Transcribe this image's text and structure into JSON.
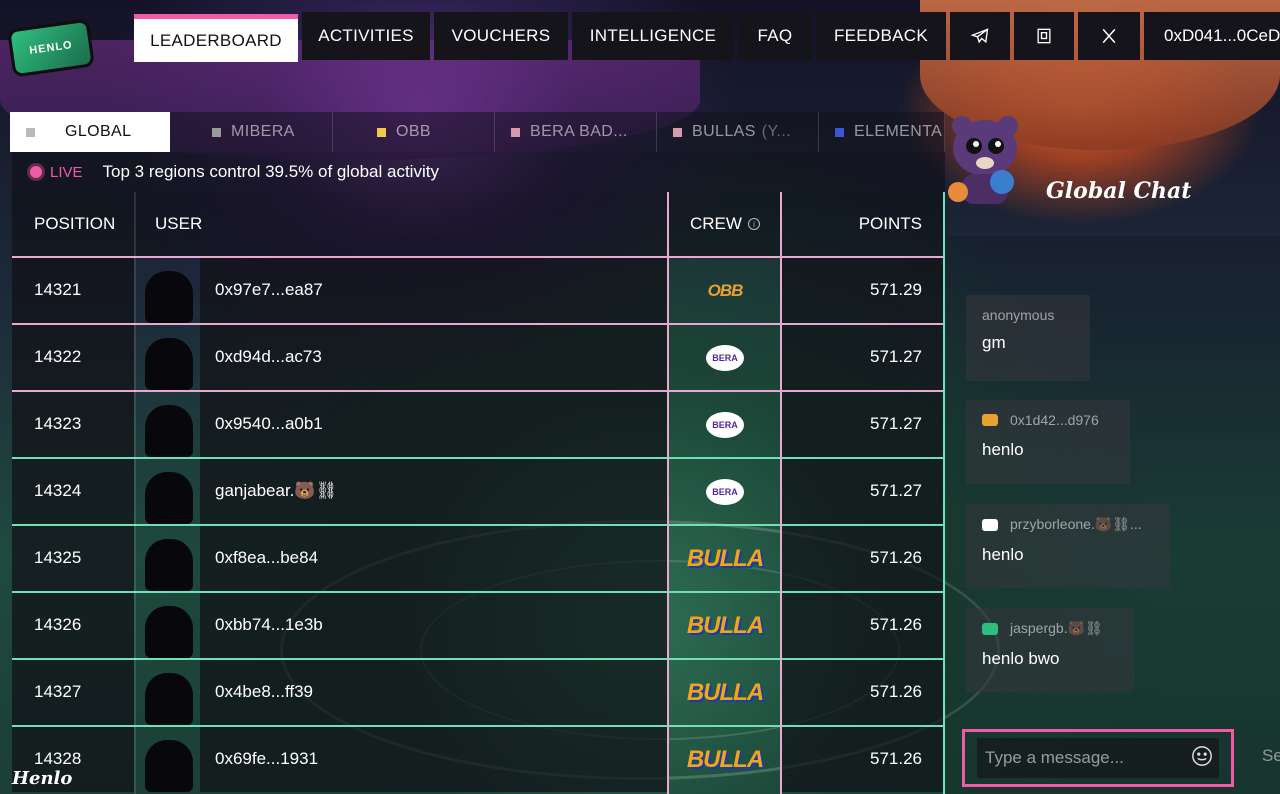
{
  "brand": {
    "logo_text": "HENLO",
    "footer_logo": "Henlo"
  },
  "nav": {
    "items": [
      {
        "label": "LEADERBOARD",
        "active": true
      },
      {
        "label": "ACTIVITIES"
      },
      {
        "label": "VOUCHERS"
      },
      {
        "label": "INTELLIGENCE"
      },
      {
        "label": "FAQ"
      },
      {
        "label": "FEEDBACK"
      }
    ],
    "icons": [
      "telegram-icon",
      "discord-icon",
      "x-icon"
    ],
    "wallet": "0xD041...0CeD"
  },
  "tabs": [
    {
      "label": "GLOBAL",
      "active": true,
      "color": "#b9b9b9"
    },
    {
      "label": "MIBERA",
      "color": "#9a9a9a"
    },
    {
      "label": "OBB",
      "color": "#f2c94c"
    },
    {
      "label": "BERA BAD...",
      "color": "#d49ab0"
    },
    {
      "label": "BULLAS",
      "suffix": "(Y...",
      "color": "#d49ab0"
    },
    {
      "label": "ELEMENTA",
      "color": "#3a56d4"
    }
  ],
  "live": {
    "label": "LIVE",
    "text": "Top 3 regions control 39.5% of global activity"
  },
  "table": {
    "headers": {
      "position": "POSITION",
      "user": "USER",
      "crew": "CREW",
      "points": "POINTS"
    },
    "rows": [
      {
        "position": "14321",
        "user": "0x97e7...ea87",
        "crew": "OBB",
        "points": "571.29"
      },
      {
        "position": "14322",
        "user": "0xd94d...ac73",
        "crew": "BERA BADDIES",
        "points": "571.27"
      },
      {
        "position": "14323",
        "user": "0x9540...a0b1",
        "crew": "BERA BADDIES",
        "points": "571.27"
      },
      {
        "position": "14324",
        "user": "ganjabear.🐻⛓",
        "crew": "BERA BADDIES",
        "points": "571.27"
      },
      {
        "position": "14325",
        "user": "0xf8ea...be84",
        "crew": "BULLA",
        "points": "571.26"
      },
      {
        "position": "14326",
        "user": "0xbb74...1e3b",
        "crew": "BULLA",
        "points": "571.26"
      },
      {
        "position": "14327",
        "user": "0x4be8...ff39",
        "crew": "BULLA",
        "points": "571.26"
      },
      {
        "position": "14328",
        "user": "0x69fe...1931",
        "crew": "BULLA",
        "points": "571.26"
      }
    ]
  },
  "chat": {
    "title": "Global Chat",
    "messages": [
      {
        "author": "anonymous",
        "text": "gm"
      },
      {
        "author": "0x1d42...d976",
        "text": "henlo"
      },
      {
        "author": "przyborleone.🐻⛓...",
        "text": "henlo"
      },
      {
        "author": "jaspergb.🐻⛓",
        "text": "henlo bwo"
      }
    ],
    "input_placeholder": "Type a message...",
    "send_label": "Se"
  }
}
